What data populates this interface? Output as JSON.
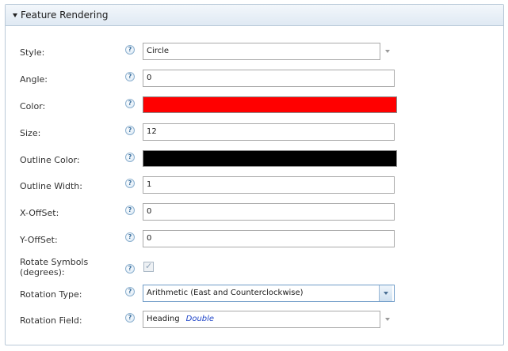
{
  "panel": {
    "title": "Feature Rendering"
  },
  "help_glyph": "?",
  "fields": {
    "style": {
      "label": "Style:",
      "value": "Circle"
    },
    "angle": {
      "label": "Angle:",
      "value": "0"
    },
    "color": {
      "label": "Color:",
      "color": "#ff0000"
    },
    "size": {
      "label": "Size:",
      "value": "12"
    },
    "outline_color": {
      "label": "Outline Color:",
      "color": "#000000"
    },
    "outline_width": {
      "label": "Outline Width:",
      "value": "1"
    },
    "x_offset": {
      "label": "X-OffSet:",
      "value": "0"
    },
    "y_offset": {
      "label": "Y-OffSet:",
      "value": "0"
    },
    "rotate_symbols": {
      "label_line1": "Rotate Symbols",
      "label_line2": "(degrees):",
      "checked": true,
      "check_glyph": "✓"
    },
    "rotation_type": {
      "label": "Rotation Type:",
      "value": "Arithmetic (East and Counterclockwise)"
    },
    "rotation_field": {
      "label": "Rotation Field:",
      "value": "Heading",
      "type": "Double"
    }
  },
  "colors": {
    "header_border": "#b9c9d8",
    "help_icon": "#3a6f9e",
    "field_type_text": "#1f45c8"
  }
}
